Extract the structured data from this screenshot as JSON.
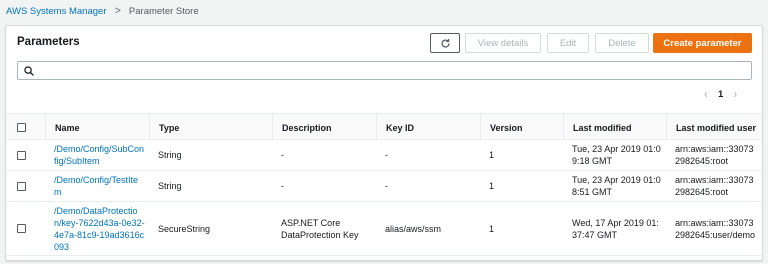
{
  "breadcrumb": {
    "root": "AWS Systems Manager",
    "separator": ">",
    "current": "Parameter Store"
  },
  "panel": {
    "title": "Parameters"
  },
  "toolbar": {
    "refresh_icon": "↻",
    "view_details": "View details",
    "edit": "Edit",
    "delete": "Delete",
    "create": "Create parameter"
  },
  "search": {
    "icon": "search-icon",
    "placeholder": "",
    "value": ""
  },
  "pagination": {
    "prev": "‹",
    "page": "1",
    "next": "›"
  },
  "table": {
    "columns": [
      "Name",
      "Type",
      "Description",
      "Key ID",
      "Version",
      "Last modified",
      "Last modified user"
    ],
    "rows": [
      {
        "name": "/Demo/Config/SubConfig/SubItem",
        "type": "String",
        "description": "-",
        "key_id": "-",
        "version": "1",
        "last_modified": "Tue, 23 Apr 2019 01:09:18 GMT",
        "last_modified_user": "arn:aws:iam::330732982645:root"
      },
      {
        "name": "/Demo/Config/TestItem",
        "type": "String",
        "description": "-",
        "key_id": "-",
        "version": "1",
        "last_modified": "Tue, 23 Apr 2019 01:08:51 GMT",
        "last_modified_user": "arn:aws:iam::330732982645:root"
      },
      {
        "name": "/Demo/DataProtection/key-7622d43a-0e32-4e7a-81c9-19ad3616c093",
        "type": "SecureString",
        "description": "ASP.NET Core DataProtection Key",
        "key_id": "alias/aws/ssm",
        "version": "1",
        "last_modified": "Wed, 17 Apr 2019 01:37:47 GMT",
        "last_modified_user": "arn:aws:iam::330732982645:user/demo"
      }
    ]
  },
  "colors": {
    "accent": "#ec7211",
    "link": "#0073bb",
    "background": "#f2f3f3"
  }
}
